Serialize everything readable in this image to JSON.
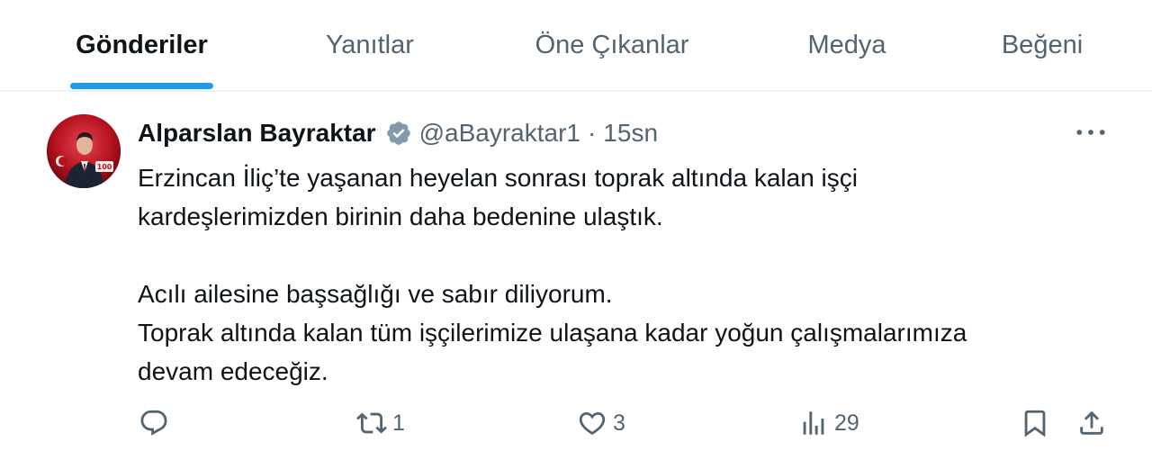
{
  "tabs": [
    {
      "label": "Gönderiler",
      "active": true
    },
    {
      "label": "Yanıtlar",
      "active": false
    },
    {
      "label": "Öne Çıkanlar",
      "active": false
    },
    {
      "label": "Medya",
      "active": false
    },
    {
      "label": "Beğeni",
      "active": false
    }
  ],
  "tweet": {
    "author_name": "Alparslan Bayraktar",
    "verified_badge_icon": "verified-badge-icon",
    "handle": "@aBayraktar1",
    "separator": "·",
    "time": "15sn",
    "lines": [
      "Erzincan İliç’te yaşanan heyelan sonrası toprak altında kalan işçi",
      "kardeşlerimizden birinin daha bedenine ulaştık.",
      "Acılı ailesine başsağlığı ve sabır diliyorum.",
      "Toprak altında kalan tüm işçilerimize ulaşana kadar yoğun çalışmalarımıza",
      "devam edeceğiz."
    ],
    "actions": {
      "reply": {
        "icon": "reply-icon",
        "count": ""
      },
      "retweet": {
        "icon": "retweet-icon",
        "count": "1"
      },
      "like": {
        "icon": "heart-icon",
        "count": "3"
      },
      "views": {
        "icon": "views-icon",
        "count": "29"
      },
      "bookmark": {
        "icon": "bookmark-icon"
      },
      "share": {
        "icon": "share-icon"
      }
    }
  },
  "colors": {
    "accent": "#1d9bf0",
    "text_primary": "#0f1419",
    "text_secondary": "#536471",
    "verified_badge": "#829aab"
  }
}
